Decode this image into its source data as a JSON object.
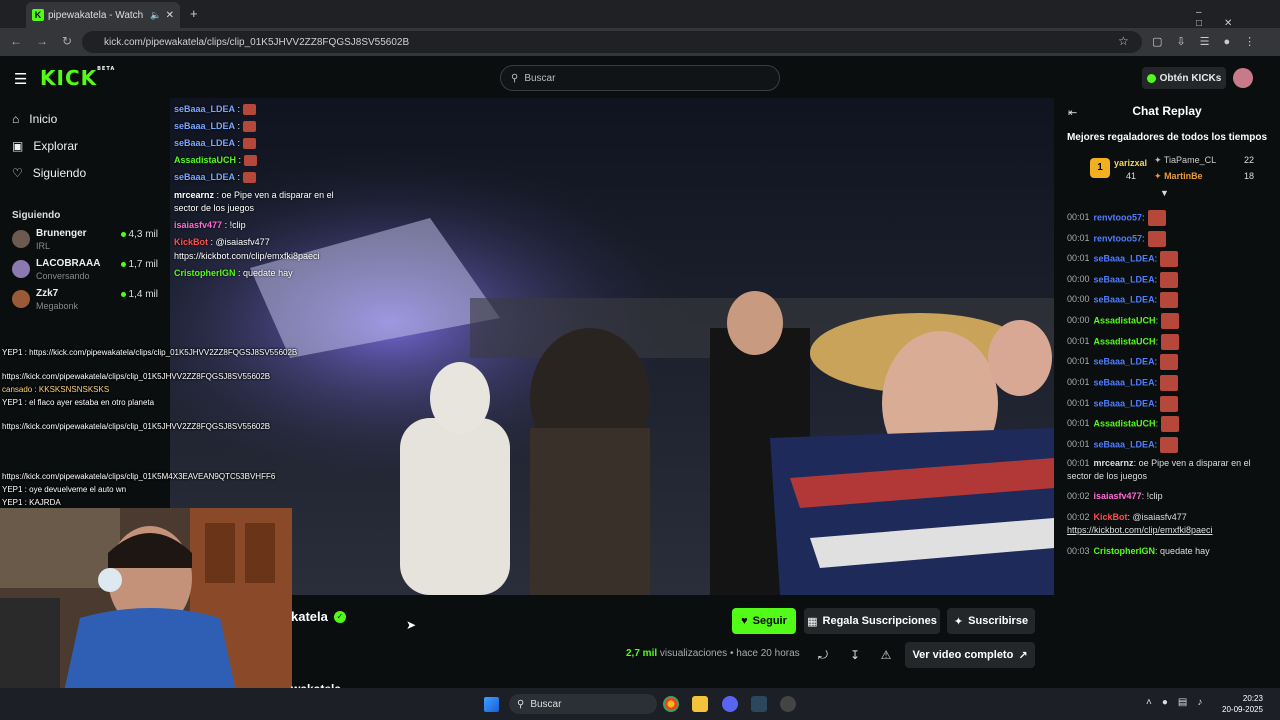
{
  "browser": {
    "tab_title": "pipewakatela - Watch clips",
    "url": "kick.com/pipewakatela/clips/clip_01K5JHVV2ZZ8FQGSJ8SV55602B"
  },
  "header": {
    "logo": "KICK",
    "logo_badge": "BETA",
    "search_placeholder": "Buscar",
    "get_kicks": "Obtén KICKs"
  },
  "sidebar": {
    "nav": [
      {
        "label": "Inicio"
      },
      {
        "label": "Explorar"
      },
      {
        "label": "Siguiendo"
      }
    ],
    "following_heading": "Siguiendo",
    "following": [
      {
        "name": "Brunenger",
        "category": "IRL",
        "viewers": "4,3 mil"
      },
      {
        "name": "LACOBRAAA",
        "category": "Conversando",
        "viewers": "1,7 mil"
      },
      {
        "name": "Zzk7",
        "category": "Megabonk",
        "viewers": "1,4 mil"
      }
    ]
  },
  "overlay_chat": [
    {
      "name": "seBaaa_LDEA",
      "text": ":"
    },
    {
      "name": "seBaaa_LDEA",
      "text": ":"
    },
    {
      "name": "seBaaa_LDEA",
      "text": ":"
    },
    {
      "name": "AssadistaUCH",
      "text": ":"
    },
    {
      "name": "seBaaa_LDEA",
      "text": ":"
    },
    {
      "name": "mrcearnz",
      "text": ": oe Pipe ven a disparar en el"
    },
    {
      "name": "",
      "text": "sector de los juegos"
    },
    {
      "name": "isaiasfv477",
      "text": ": !clip"
    },
    {
      "name": "KickBot",
      "text": ": @isaiasfv477"
    },
    {
      "name": "",
      "text": "https://kickbot.com/clip/emxfki8paeci"
    },
    {
      "name": "CristopherIGN",
      "text": ": quedate hay"
    }
  ],
  "left_overlay": [
    "YEP1 : https://kick.com/pipewakatela/clips/clip_01K5JHVV2ZZ8FQGSJ8SV55602B",
    "https://kick.com/pipewakatela/clips/clip_01K5JHVV2ZZ8FQGSJ8SV55602B",
    "cansado : KKSKSNSNSKSKS",
    "YEP1 : el flaco ayer estaba en otro planeta",
    "https://kick.com/pipewakatela/clips/clip_01K5JHVV2ZZ8FQGSJ8SV55602B",
    "https://kick.com/pipewakatela/clips/clip_01K5M4X3EAVEAN9QTC53BVHFF6",
    "YEP1 : oye devuelveme el auto wn",
    "YEP1 : KAJRDA"
  ],
  "channel": {
    "name": "katela",
    "follow": "Seguir",
    "gift_subs": "Regala Suscripciones",
    "subscribe": "Suscribirse",
    "views": "2,7 mil",
    "views_label": "visualizaciones",
    "separator": "•",
    "time_ago": "hace 20 horas",
    "full_video": "Ver video completo",
    "footer_partial": "wakatela"
  },
  "chat": {
    "title": "Chat Replay",
    "top_gifters_title": "Mejores regaladores de todos los tiempos",
    "top_gifters": [
      {
        "rank": "1",
        "name": "yarizxal",
        "count": "41"
      },
      {
        "rank": "2",
        "name": "TiaPame_CL",
        "count": "22"
      },
      {
        "rank": "3",
        "name": "MartinBe",
        "count": "18"
      }
    ],
    "messages": [
      {
        "time": "00:01",
        "name": "renvtooo57",
        "text": ":",
        "color": "#4f7dff"
      },
      {
        "time": "00:01",
        "name": "renvtooo57",
        "text": ":",
        "color": "#4f7dff"
      },
      {
        "time": "00:01",
        "name": "seBaaa_LDEA",
        "text": ":",
        "color": "#4f7dff"
      },
      {
        "time": "00:00",
        "name": "seBaaa_LDEA",
        "text": ":",
        "color": "#4f7dff"
      },
      {
        "time": "00:00",
        "name": "seBaaa_LDEA",
        "text": ":",
        "color": "#4f7dff"
      },
      {
        "time": "00:00",
        "name": "AssadistaUCH",
        "text": ":",
        "color": "#53fc18"
      },
      {
        "time": "00:01",
        "name": "AssadistaUCH",
        "text": ":",
        "color": "#53fc18"
      },
      {
        "time": "00:01",
        "name": "seBaaa_LDEA",
        "text": ":",
        "color": "#4f7dff"
      },
      {
        "time": "00:01",
        "name": "seBaaa_LDEA",
        "text": ":",
        "color": "#4f7dff"
      },
      {
        "time": "00:01",
        "name": "seBaaa_LDEA",
        "text": ":",
        "color": "#4f7dff"
      },
      {
        "time": "00:01",
        "name": "AssadistaUCH",
        "text": ":",
        "color": "#53fc18"
      },
      {
        "time": "00:01",
        "name": "seBaaa_LDEA",
        "text": ":",
        "color": "#4f7dff"
      },
      {
        "time": "00:01",
        "name": "mrcearnz",
        "text": ": oe Pipe ven a disparar en el",
        "color": "#dddddd"
      },
      {
        "time": "",
        "name": "",
        "text": "sector de los juegos",
        "color": "#dddddd"
      },
      {
        "time": "00:02",
        "name": "isaiasfv477",
        "text": ": !clip",
        "color": "#ff6ad5"
      },
      {
        "time": "00:02",
        "name": "KickBot",
        "text": ": @isaiasfv477",
        "color": "#ff4d4d"
      },
      {
        "time": "",
        "name": "",
        "text": "https://kickbot.com/clip/emxfki8paeci",
        "color": "#dddddd"
      },
      {
        "time": "00:03",
        "name": "CristopherIGN",
        "text": ": quedate hay",
        "color": "#53fc18"
      }
    ]
  },
  "taskbar": {
    "search": "Buscar",
    "time": "20:23",
    "date": "20-09-2025"
  }
}
